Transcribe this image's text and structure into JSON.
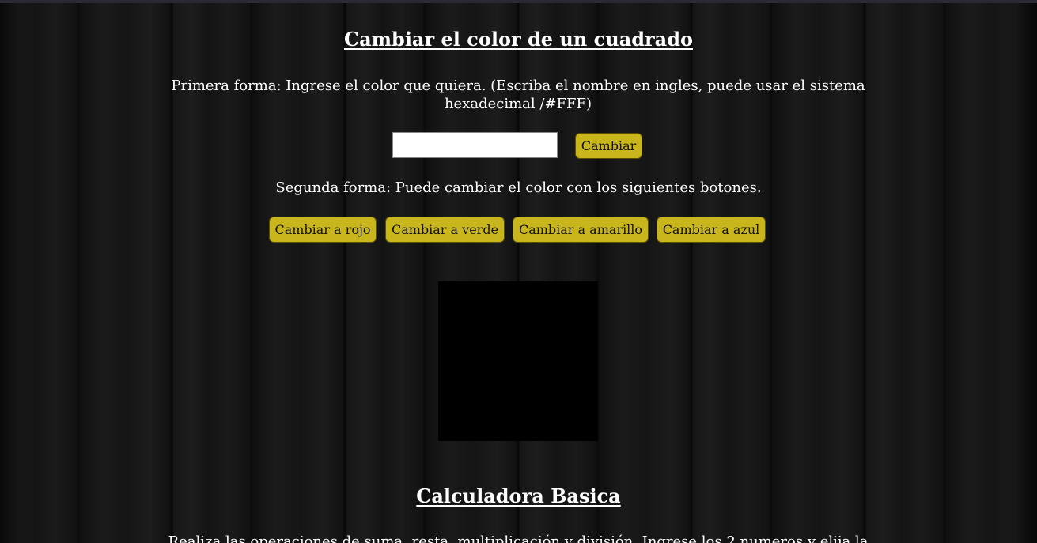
{
  "color_section": {
    "title": "Cambiar el color de un cuadrado",
    "first_method_text": "Primera forma: Ingrese el color que quiera. (Escriba el nombre en ingles, puede usar el sistema hexadecimal /#FFF)",
    "color_input": {
      "value": "",
      "placeholder": ""
    },
    "change_button_label": "Cambiar",
    "second_method_text": "Segunda forma: Puede cambiar el color con los siguientes botones.",
    "color_buttons": {
      "red": "Cambiar a rojo",
      "green": "Cambiar a verde",
      "yellow": "Cambiar a amarillo",
      "blue": "Cambiar a azul"
    },
    "square_color": "#000000",
    "button_color": "#c9b61c"
  },
  "calculator_section": {
    "title": "Calculadora Basica",
    "intro_text": "Realiza las operaciones de suma, resta, multiplicación y división. Ingrese los 2 numeros y elija la"
  }
}
